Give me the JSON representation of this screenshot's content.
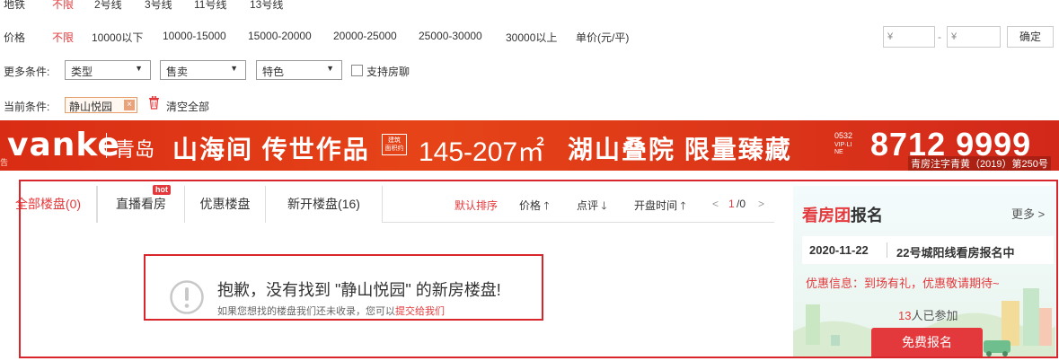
{
  "filters": {
    "subway": {
      "label": "地铁",
      "options": [
        "不限",
        "2号线",
        "3号线",
        "11号线",
        "13号线"
      ]
    },
    "price": {
      "label": "价格",
      "options": [
        "不限",
        "10000以下",
        "10000-15000",
        "15000-20000",
        "20000-25000",
        "25000-30000",
        "30000以上"
      ],
      "unit_label": "单价(元/平)",
      "min_placeholder": "¥",
      "max_placeholder": "¥",
      "dash": "-",
      "confirm_label": "确定"
    },
    "more": {
      "label": "更多条件:",
      "selects": [
        "类型",
        "售卖",
        "特色"
      ],
      "checkbox_label": "支持房聊"
    },
    "current": {
      "label": "当前条件:",
      "tag": "静山悦园",
      "tag_close": "×",
      "clear_label": "清空全部"
    }
  },
  "banner": {
    "brand": "vanke",
    "city": "青岛",
    "headline": "山海间 传世作品",
    "badge": "建筑\n面积约",
    "area": "145-207㎡",
    "slogan": "湖山叠院 限量臻藏",
    "hotline_code": "0532",
    "hotline_label": "VIP·LINE",
    "phone": "8712 9999",
    "permit": "青房注字青黄（2019）第250号",
    "left_edge": "告"
  },
  "tabs": [
    {
      "label": "全部楼盘(0)",
      "active": true
    },
    {
      "label": "直播看房",
      "badge": "hot"
    },
    {
      "label": "优惠楼盘"
    },
    {
      "label": "新开楼盘(16)"
    }
  ],
  "sorts": {
    "default": "默认排序",
    "price": "价格",
    "review": "点评",
    "open_time": "开盘时间",
    "page_prev": "<",
    "page_current": "1",
    "page_total": "/0",
    "page_next": ">"
  },
  "empty_result": {
    "title": "抱歉，没有找到 \"静山悦园\" 的新房楼盘!",
    "hint_prefix": "如果您想找的楼盘我们还未收录，您可以",
    "hint_link": "提交给我们"
  },
  "side": {
    "title_red": "看房团",
    "title_black": "报名",
    "more": "更多 >",
    "date": "2020-11-22",
    "route": "22号城阳线看房报名中",
    "promo": "优惠信息：到场有礼，优惠敬请期待~",
    "joined_count": "13",
    "joined_suffix": "人已参加",
    "signup": "免费报名"
  },
  "colors": {
    "accent": "#e4393c",
    "banner_bg": "#d92c14",
    "frame": "#d9262c"
  }
}
